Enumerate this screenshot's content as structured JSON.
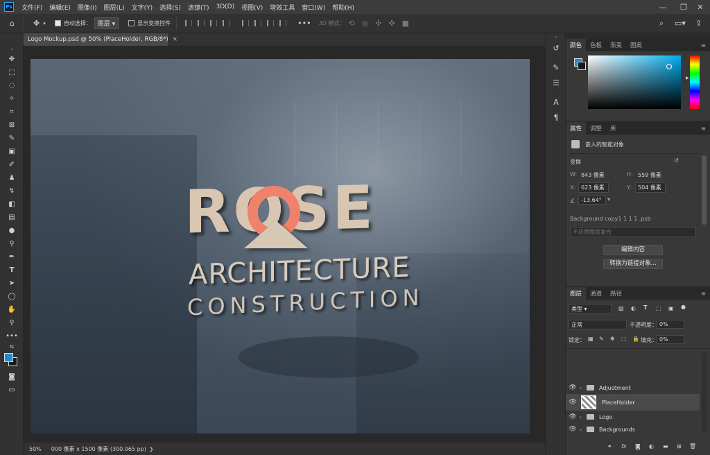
{
  "app": {
    "logo": "Ps"
  },
  "menu": [
    "文件(F)",
    "编辑(E)",
    "图像(I)",
    "图层(L)",
    "文字(Y)",
    "选择(S)",
    "滤镜(T)",
    "3D(D)",
    "视图(V)",
    "增效工具",
    "窗口(W)",
    "帮助(H)"
  ],
  "options": {
    "auto_select_label": "自动选择：",
    "auto_select_value": "图层",
    "show_transform_label": "显示变换控件",
    "mode3d_label": "3D 模式："
  },
  "document": {
    "tab_title": "Logo Mockup.psd @ 50% (PlaceHolder, RGB/8*)",
    "close": "×"
  },
  "artwork": {
    "line1": "ROSE",
    "line2": "ARCHITECTURE",
    "line3": "CONSTRUCTION",
    "accent": "#f0826c"
  },
  "status": {
    "zoom": "50%",
    "doc_size": "000 像素 x 1500 像素 (300.065 pp)"
  },
  "colors": {
    "foreground": "#1e8ccc",
    "background": "#1a1a1a",
    "accent": "#1e8ccc"
  },
  "color_panel": {
    "tabs": [
      "颜色",
      "色板",
      "渐变",
      "图案"
    ]
  },
  "properties": {
    "tabs": [
      "属性",
      "调整",
      "库"
    ],
    "type_label": "嵌入的智能对象",
    "transform_label": "变换",
    "w_label": "W:",
    "w_value": "843 像素",
    "h_label": "H:",
    "h_value": "559 像素",
    "x_label": "X:",
    "x_value": "623 像素",
    "y_label": "Y:",
    "y_value": "504 像素",
    "angle_value": "-13.64°",
    "source_file": "Background copy1 1 1 1 .psb",
    "comp_placeholder": "不应用图层复合",
    "edit_btn": "编辑内容",
    "convert_btn": "转换为链接对象..."
  },
  "layers_panel": {
    "tabs": [
      "图层",
      "通道",
      "路径"
    ],
    "filter_label": "类型",
    "blend_mode": "正常",
    "opacity_label": "不透明度：",
    "opacity_value": "0%",
    "lock_label": "锁定：",
    "fill_label": "填充：",
    "fill_value": "0%",
    "layers": [
      {
        "name": "Adjustment",
        "type": "group"
      },
      {
        "name": "PlaceHolder",
        "type": "smart"
      },
      {
        "name": "Logo",
        "type": "group"
      },
      {
        "name": "Backgrounds",
        "type": "group"
      }
    ]
  }
}
